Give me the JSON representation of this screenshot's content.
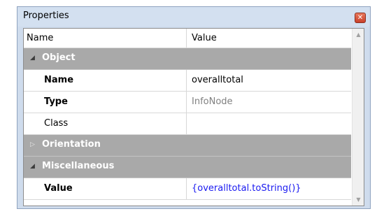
{
  "panel": {
    "title": "Properties",
    "close_icon": "close-icon"
  },
  "grid": {
    "columns": [
      "Name",
      "Value"
    ],
    "groups": [
      {
        "label": "Object",
        "expanded": true,
        "properties": [
          {
            "name": "Name",
            "value": "overalltotal"
          },
          {
            "name": "Type",
            "value": "InfoNode"
          },
          {
            "name": "Class",
            "value": ""
          }
        ]
      },
      {
        "label": "Orientation",
        "expanded": false,
        "properties": []
      },
      {
        "label": "Miscellaneous",
        "expanded": true,
        "properties": [
          {
            "name": "Value",
            "value": "{overalltotal.toString()}"
          }
        ]
      }
    ]
  },
  "colors": {
    "group_background": "#a9a9a9",
    "binding_value": "#1a1af0",
    "readonly_value": "#808080"
  }
}
